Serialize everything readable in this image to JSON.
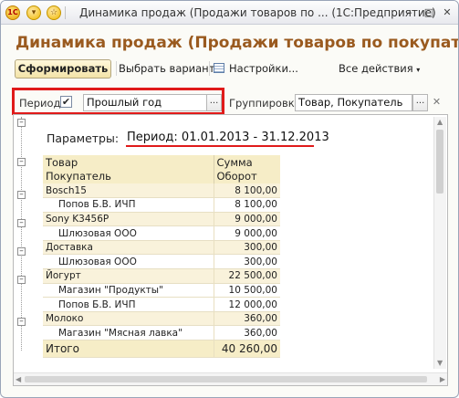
{
  "window": {
    "title": "Динамика продаж (Продажи товаров по ... (1С:Предприятие)",
    "logo_text": "1С",
    "controls": {
      "minimize": "–",
      "maximize": "□",
      "close": "✕"
    }
  },
  "report": {
    "title": "Динамика продаж (Продажи товаров по покупателям)"
  },
  "toolbar": {
    "generate_label": "Сформировать",
    "choose_variant_label": "Выбрать вариант...",
    "settings_label": "Настройки...",
    "all_actions_label": "Все действия"
  },
  "filters": {
    "period_label": "Период:",
    "period_checked": true,
    "period_value": "Прошлый год",
    "grouping_label": "Группировка:",
    "grouping_value": "Товар, Покупатель",
    "dots_label": "...",
    "clear_label": "✕"
  },
  "parameters": {
    "label": "Параметры:",
    "period_text": "Период: 01.01.2013 - 31.12.2013"
  },
  "table": {
    "header_row1": [
      "Товар",
      "Сумма"
    ],
    "header_row2": [
      "Покупатель",
      "Оборот"
    ],
    "rows": [
      {
        "name": "Bosch15",
        "value": "8 100,00",
        "type": "group"
      },
      {
        "name": "Попов Б.В. ИЧП",
        "value": "8 100,00",
        "type": "child"
      },
      {
        "name": "Sony K3456P",
        "value": "9 000,00",
        "type": "group"
      },
      {
        "name": "Шлюзовая ООО",
        "value": "9 000,00",
        "type": "child"
      },
      {
        "name": "Доставка",
        "value": "300,00",
        "type": "group"
      },
      {
        "name": "Шлюзовая ООО",
        "value": "300,00",
        "type": "child"
      },
      {
        "name": "Йогурт",
        "value": "22 500,00",
        "type": "group"
      },
      {
        "name": "Магазин \"Продукты\"",
        "value": "10 500,00",
        "type": "child"
      },
      {
        "name": "Попов Б.В. ИЧП",
        "value": "12 000,00",
        "type": "child"
      },
      {
        "name": "Молоко",
        "value": "360,00",
        "type": "group"
      },
      {
        "name": "Магазин \"Мясная лавка\"",
        "value": "360,00",
        "type": "child"
      }
    ],
    "total": {
      "name": "Итого",
      "value": "40 260,00"
    }
  }
}
